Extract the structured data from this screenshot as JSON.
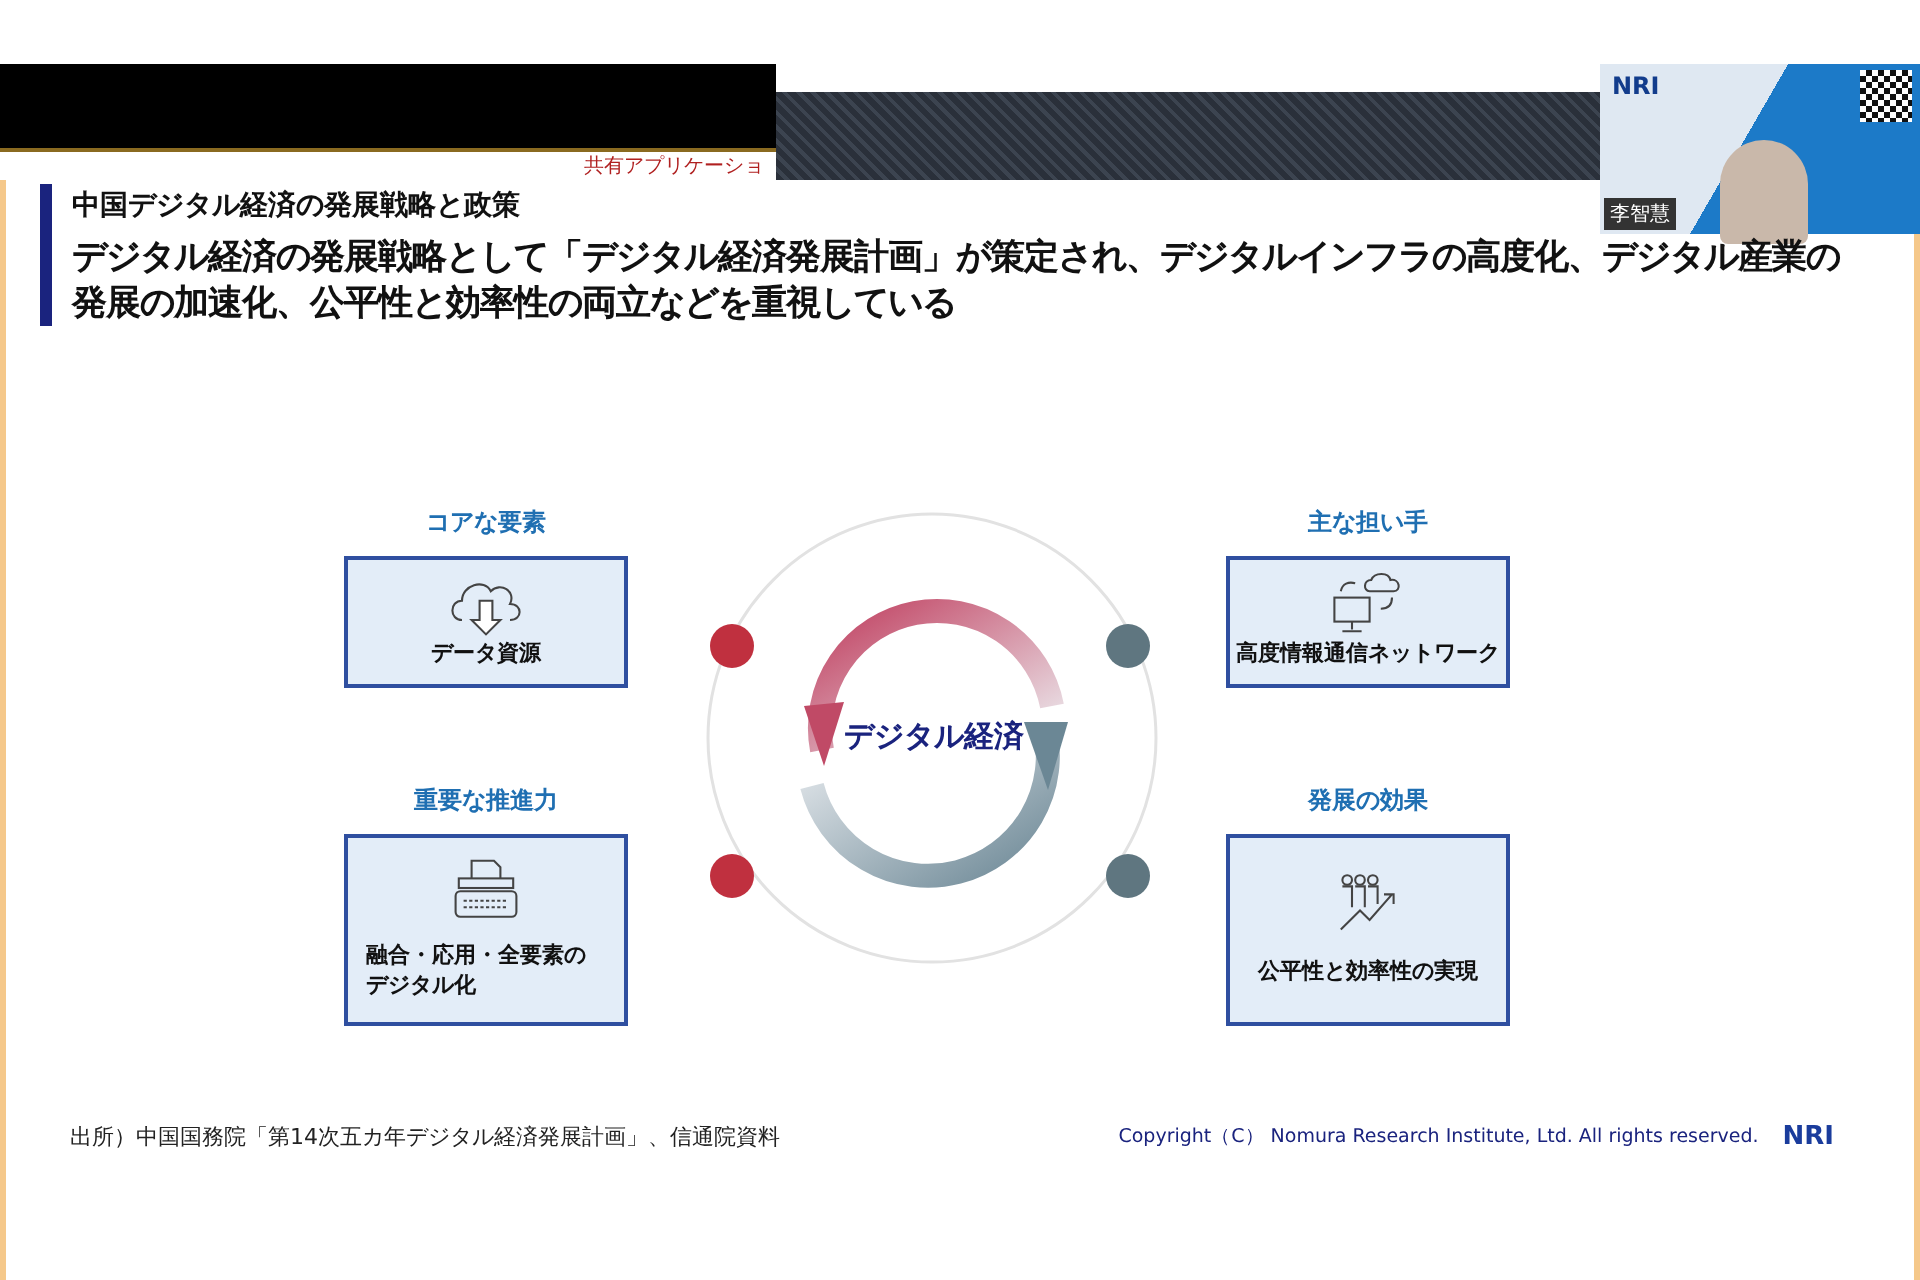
{
  "share_bar": {
    "label": "共有アプリケーショ"
  },
  "video": {
    "logo": "NRI",
    "name_tag": "李智慧"
  },
  "slide": {
    "subtitle": "中国デジタル経済の発展戦略と政策",
    "title": "デジタル経済の発展戦略として「デジタル経済発展計画」が策定され、デジタルインフラの高度化、デジタル産業の発展の加速化、公平性と効率性の両立などを重視している",
    "diagram": {
      "center": "デジタル経済",
      "elements": [
        {
          "kind": "cloud",
          "heading": "コアな要素",
          "label": "データ資源",
          "color": "#c0303f"
        },
        {
          "kind": "network",
          "heading": "主な担い手",
          "label": "高度情報通信ネットワーク",
          "color": "#5f7680"
        },
        {
          "kind": "typewriter",
          "heading": "重要な推進力",
          "label": "融合・応用・全要素のデジタル化",
          "color": "#c0303f"
        },
        {
          "kind": "growth",
          "heading": "発展の効果",
          "label": "公平性と効率性の実現",
          "color": "#5f7680"
        }
      ]
    },
    "source": "出所）中国国務院「第14次五カ年デジタル経済発展計画」、信通院資料",
    "copyright": "Copyright（C） Nomura Research Institute, Ltd. All rights reserved.",
    "logo": "NRI"
  }
}
